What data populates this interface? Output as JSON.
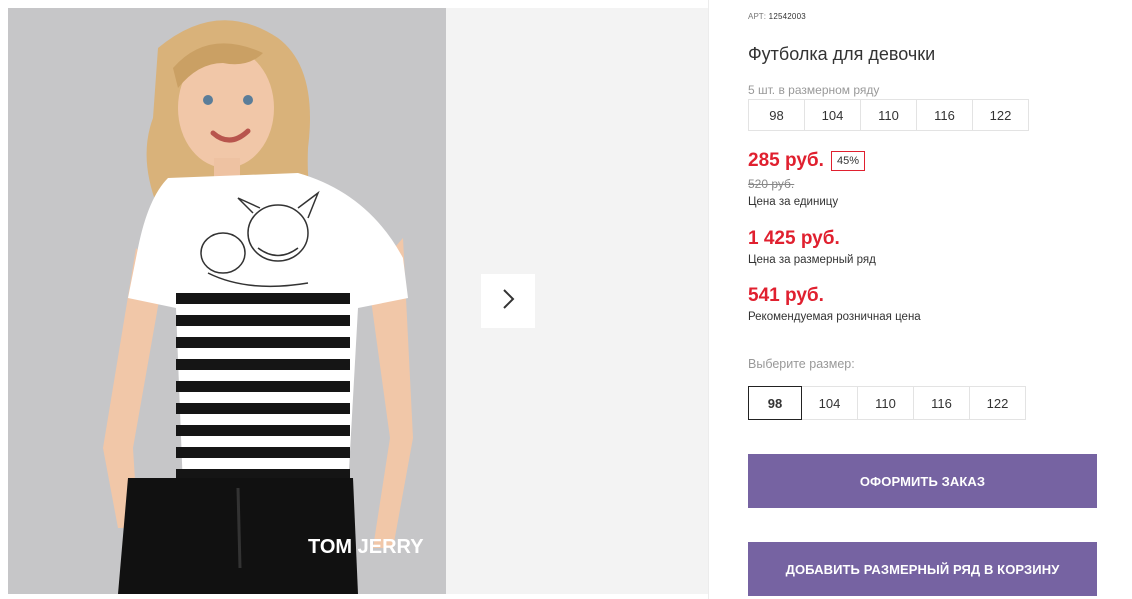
{
  "product": {
    "art_label": "АРТ:",
    "art_number": "12542003",
    "title": "Футболка для девочки",
    "pack_label": "5 шт. в размерном ряду",
    "pack_sizes": [
      "98",
      "104",
      "110",
      "116",
      "122"
    ]
  },
  "prices": {
    "unit_price": "285 руб.",
    "discount_badge": "45%",
    "old_price": "520 руб.",
    "unit_note": "Цена за единицу",
    "pack_price": "1 425 руб.",
    "pack_note": "Цена за размерный ряд",
    "retail_price": "541 руб.",
    "retail_note": "Рекомендуемая розничная цена"
  },
  "size_selector": {
    "label": "Выберите размер:",
    "options": [
      "98",
      "104",
      "110",
      "116",
      "122"
    ],
    "selected": "98"
  },
  "actions": {
    "order_label": "ОФОРМИТЬ ЗАКАЗ",
    "add_cart_label": "ДОБАВИТЬ РАЗМЕРНЫЙ РЯД В КОРЗИНУ"
  },
  "gallery": {
    "next_icon": "chevron-right-icon",
    "shorts_print": "TOM JERRY"
  },
  "colors": {
    "accent": "#7663a2",
    "price_red": "#e0202f"
  }
}
